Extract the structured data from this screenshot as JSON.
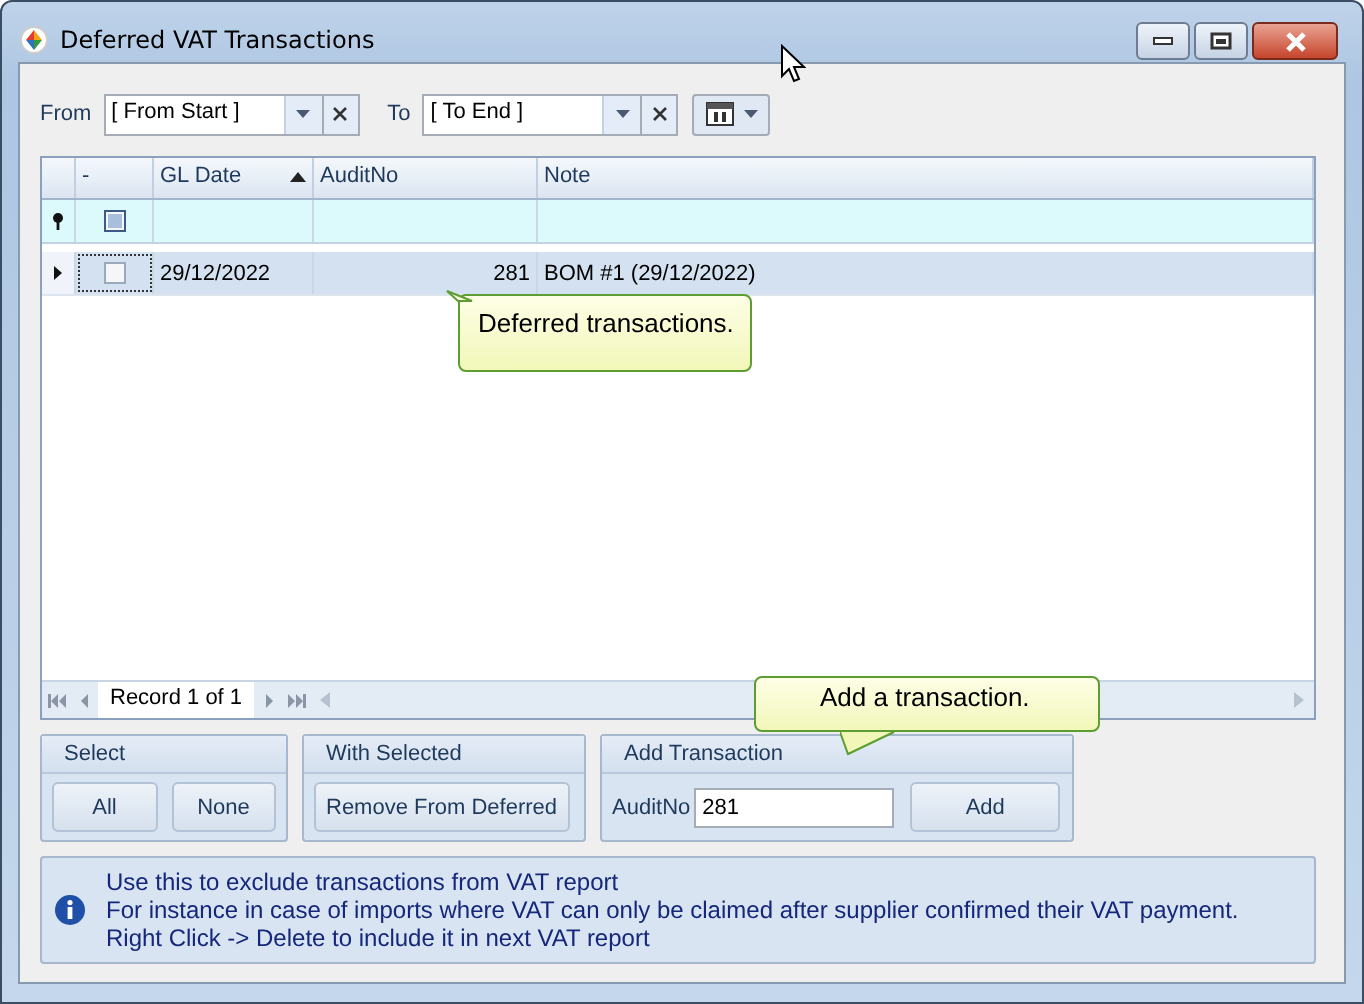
{
  "window": {
    "title": "Deferred VAT Transactions"
  },
  "filter": {
    "from_label": "From",
    "from_value": "[ From Start ]",
    "to_label": "To",
    "to_value": "[ To End ]"
  },
  "table": {
    "columns": [
      {
        "label": "-",
        "sorted": false
      },
      {
        "label": "GL Date",
        "sorted": true
      },
      {
        "label": "AuditNo",
        "sorted": false
      },
      {
        "label": "Note",
        "sorted": false
      }
    ],
    "filter_row": {
      "indeterminate": true
    },
    "rows": [
      {
        "selected": true,
        "checked": false,
        "gl_date": "29/12/2022",
        "audit_no": "281",
        "note": "BOM #1 (29/12/2022)"
      }
    ]
  },
  "navigator": {
    "text": "Record 1 of 1"
  },
  "tooltips": [
    {
      "text": "Deferred transactions."
    },
    {
      "text": "Add a transaction."
    }
  ],
  "select_group": {
    "title": "Select",
    "buttons": [
      "All",
      "None"
    ]
  },
  "with_selected_group": {
    "title": "With Selected",
    "buttons": [
      "Remove From Deferred"
    ]
  },
  "add_group": {
    "title": "Add Transaction",
    "field_label": "AuditNo",
    "field_value": "281",
    "button": "Add"
  },
  "info": {
    "lines": [
      "Use this to exclude transactions from VAT report",
      "For instance in case of imports where VAT can only be claimed after supplier confirmed their VAT payment.",
      "Right Click -> Delete to include it in next VAT report"
    ]
  }
}
